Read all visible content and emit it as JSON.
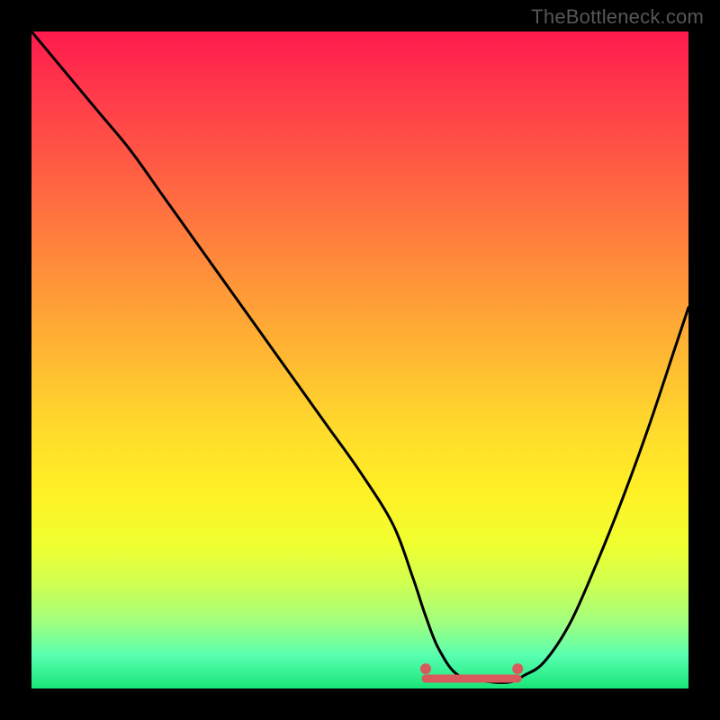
{
  "watermark": "TheBottleneck.com",
  "chart_data": {
    "type": "line",
    "title": "",
    "xlabel": "",
    "ylabel": "",
    "xlim": [
      0,
      100
    ],
    "ylim": [
      0,
      100
    ],
    "series": [
      {
        "name": "bottleneck-curve",
        "x": [
          0,
          5,
          10,
          15,
          20,
          25,
          30,
          35,
          40,
          45,
          50,
          55,
          58,
          60,
          62,
          65,
          70,
          73,
          75,
          78,
          82,
          86,
          90,
          94,
          98,
          100
        ],
        "values": [
          100,
          94,
          88,
          82,
          75,
          68,
          61,
          54,
          47,
          40,
          33,
          25,
          17,
          11,
          6,
          2,
          1,
          1,
          2,
          4,
          10,
          19,
          29,
          40,
          52,
          58
        ]
      }
    ],
    "markers": [
      {
        "name": "optimal-left",
        "x": 60,
        "y": 3,
        "color": "#d85a5a",
        "r": 6
      },
      {
        "name": "optimal-right",
        "x": 74,
        "y": 3,
        "color": "#d85a5a",
        "r": 6
      }
    ],
    "optimal_band": {
      "x_start": 60,
      "x_end": 74,
      "y": 1.5,
      "color": "#d85a5a",
      "thickness": 9
    },
    "gradient_scale_note": "y=0 is green (no bottleneck), y=100 is red (high bottleneck)"
  }
}
